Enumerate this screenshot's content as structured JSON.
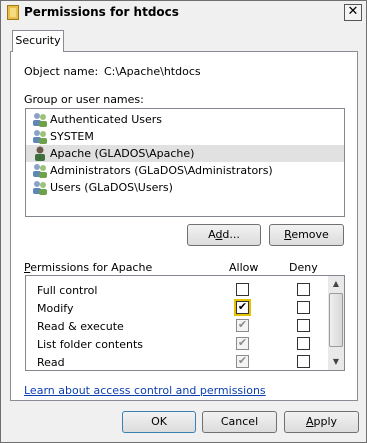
{
  "window": {
    "title": "Permissions for htdocs",
    "close_glyph": "✕"
  },
  "tab": {
    "label": "Security"
  },
  "object": {
    "label": "Object name:",
    "value": "C:\\Apache\\htdocs"
  },
  "groups": {
    "label": "Group or user names:",
    "items": [
      {
        "label": "Authenticated Users",
        "selected": false
      },
      {
        "label": "SYSTEM",
        "selected": false
      },
      {
        "label": "Apache (GLADOS\\Apache)",
        "selected": true
      },
      {
        "label": "Administrators (GLaDOS\\Administrators)",
        "selected": false
      },
      {
        "label": "Users (GLaDOS\\Users)",
        "selected": false
      }
    ]
  },
  "buttons": {
    "add_pre": "A",
    "add_u": "d",
    "add_post": "d...",
    "remove_pre": "",
    "remove_u": "R",
    "remove_post": "emove",
    "ok": "OK",
    "cancel": "Cancel",
    "apply_pre": "",
    "apply_u": "A",
    "apply_post": "pply"
  },
  "permissions": {
    "label_pre": "",
    "label_u": "P",
    "label_post": "ermissions for Apache",
    "allow_header": "Allow",
    "deny_header": "Deny",
    "rows": [
      {
        "name": "Full control",
        "allow": false,
        "deny": false
      },
      {
        "name": "Modify",
        "allow": true,
        "deny": false
      },
      {
        "name": "Read & execute",
        "allow": true,
        "deny": false
      },
      {
        "name": "List folder contents",
        "allow": true,
        "deny": false
      },
      {
        "name": "Read",
        "allow": true,
        "deny": false
      }
    ]
  },
  "link": {
    "text": "Learn about access control and permissions"
  },
  "scrollbar": {
    "up_glyph": "▲",
    "down_glyph": "▼"
  }
}
